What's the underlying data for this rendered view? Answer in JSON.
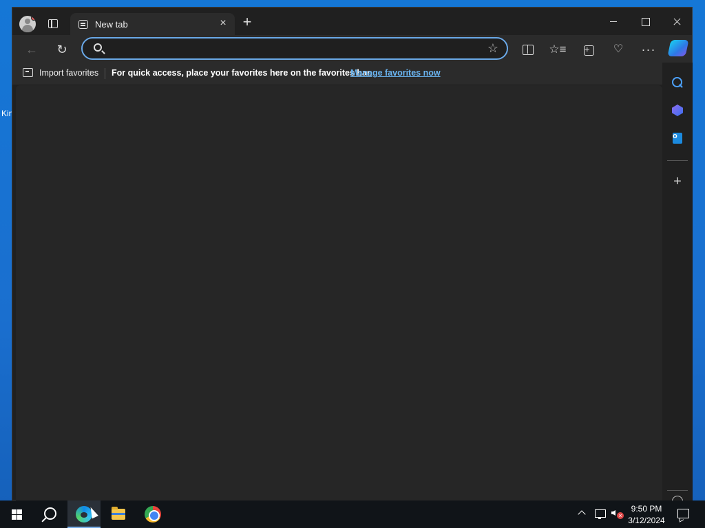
{
  "desktop": {
    "peek_text": "Kin"
  },
  "browser": {
    "tab": {
      "title": "New tab",
      "close_glyph": "×"
    },
    "new_tab_glyph": "+",
    "address_bar": {
      "value": "",
      "placeholder": ""
    },
    "toolbar": {
      "back_glyph": "←",
      "refresh_glyph": "↻",
      "favorite_glyph": "☆",
      "favorites_glyph": "☆≡",
      "performance_glyph": "♡",
      "more_glyph": "···"
    },
    "favorites_bar": {
      "import_label": "Import favorites",
      "hint": "For quick access, place your favorites here on the favorites bar.",
      "manage_link": "Manage favorites now"
    },
    "sidebar": {
      "add_glyph": "+"
    }
  },
  "taskbar": {
    "time": "9:50 PM",
    "date": "3/12/2024"
  },
  "colors": {
    "desktop": "#1a6fcf",
    "window_bg": "#202020",
    "toolbar_bg": "#2b2b2b",
    "content_bg": "#262626",
    "address_focus": "#6aa9e8",
    "link": "#6ab4f0",
    "taskbar": "#101418"
  }
}
